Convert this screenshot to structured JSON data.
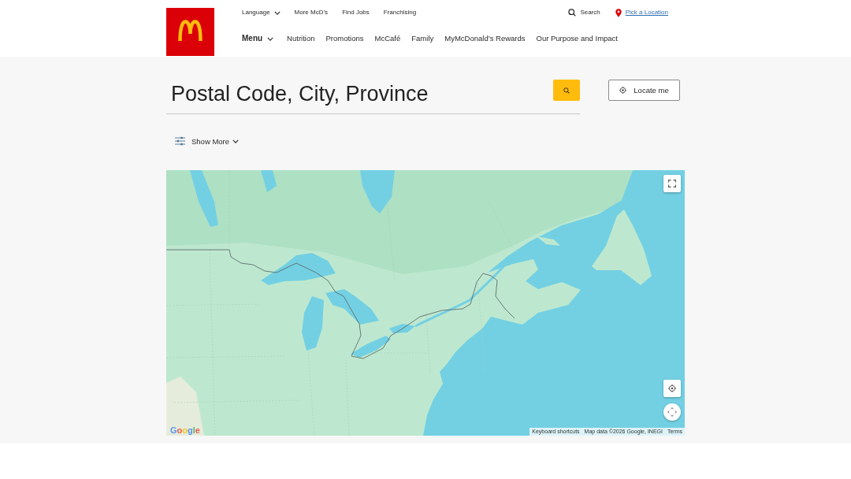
{
  "top_links": [
    {
      "label": "Language",
      "kind": "dropdown"
    },
    {
      "label": "More McD’s",
      "kind": "link"
    },
    {
      "label": "Find Jobs",
      "kind": "link"
    },
    {
      "label": "Franchising",
      "kind": "link"
    }
  ],
  "utility": {
    "search": "Search",
    "location": "Pick a Location"
  },
  "main_nav": [
    {
      "label": "Menu",
      "kind": "dropdown"
    },
    {
      "label": "Nutrition",
      "kind": "link"
    },
    {
      "label": "Promotions",
      "kind": "link"
    },
    {
      "label": "McCafé",
      "kind": "link"
    },
    {
      "label": "Family",
      "kind": "link"
    },
    {
      "label": "MyMcDonald’s Rewards",
      "kind": "link"
    },
    {
      "label": "Our Purpose and Impact",
      "kind": "link"
    }
  ],
  "search": {
    "placeholder": "Postal Code, City, Province",
    "locate_button": "Locate me"
  },
  "filters": {
    "toggle": "Show More",
    "expanded": false
  },
  "map": {
    "logo": "Google",
    "attribution": [
      "Keyboard shortcuts",
      "Map data ©2026 Google, INEGI",
      "Terms"
    ]
  }
}
